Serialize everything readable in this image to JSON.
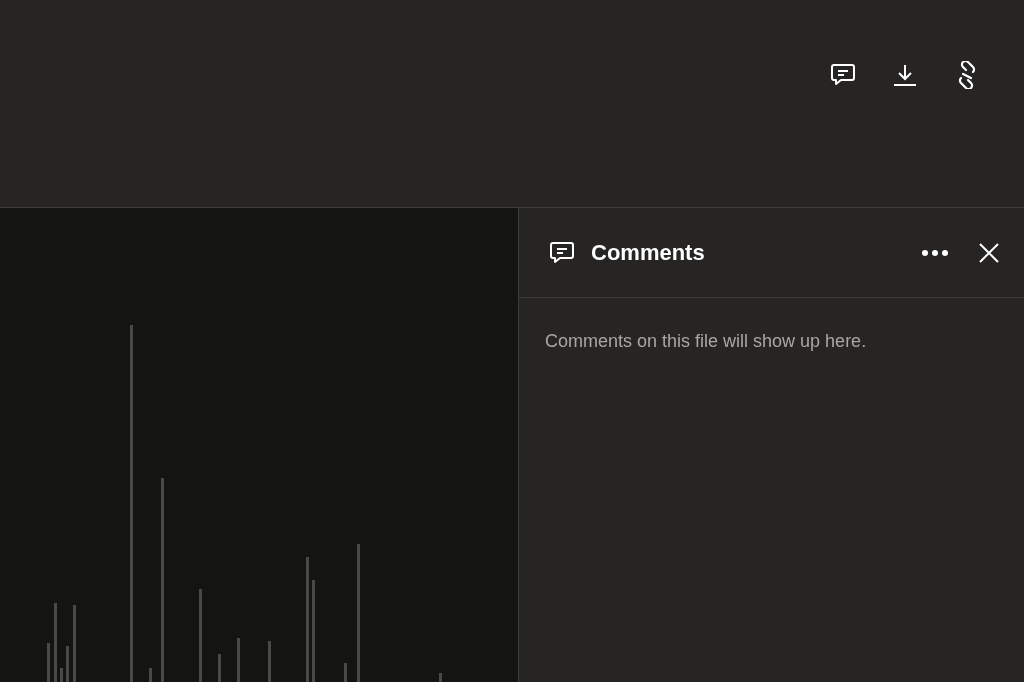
{
  "comments_panel": {
    "title": "Comments",
    "empty_message": "Comments on this file will show up here."
  }
}
